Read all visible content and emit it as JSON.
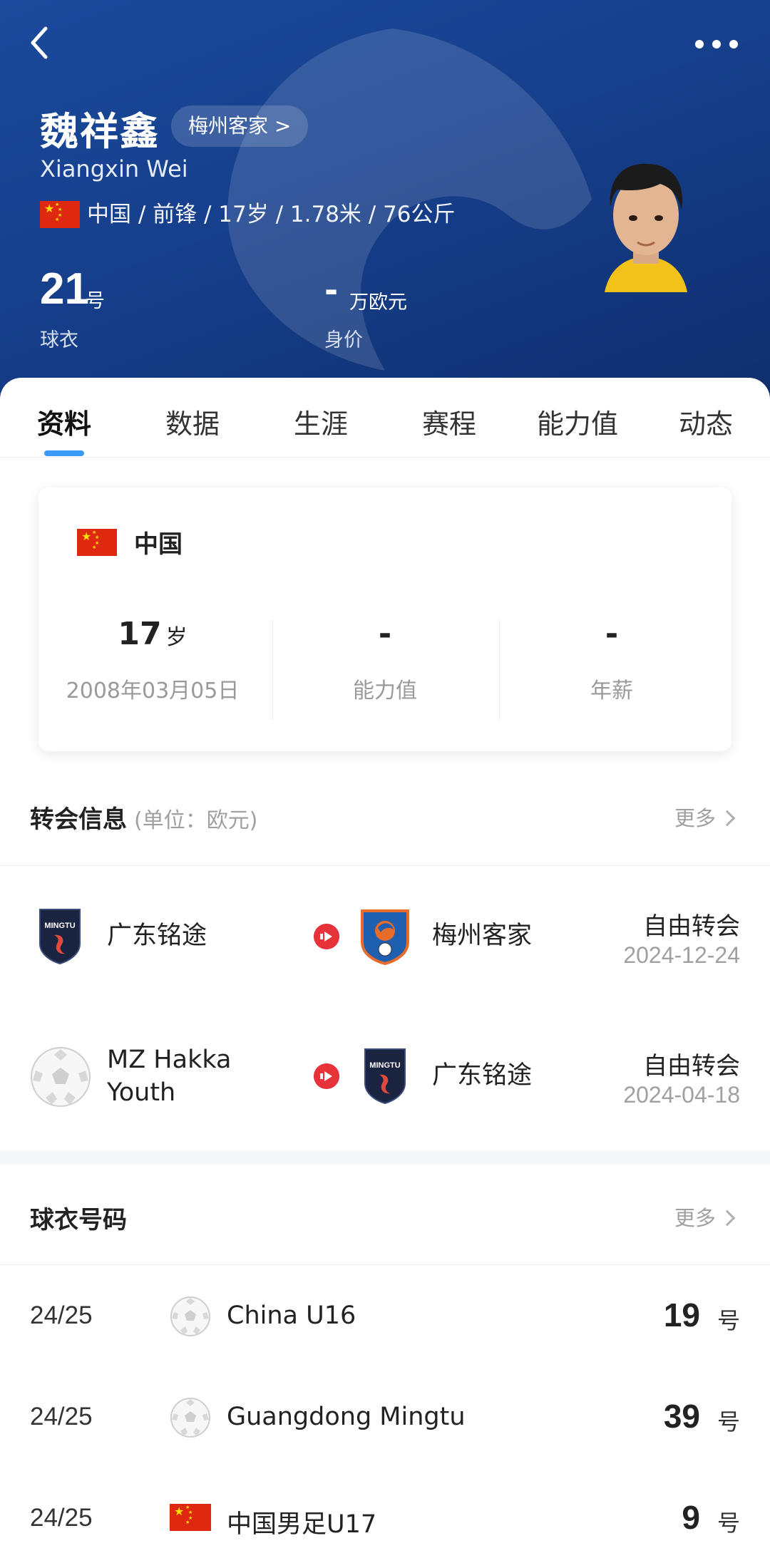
{
  "header": {
    "name_cn": "魏祥鑫",
    "team_link": "梅州客家 >",
    "name_en": "Xiangxin Wei",
    "info_line": "中国 / 前锋 / 17岁 / 1.78米 / 76公斤",
    "jersey_number": "21",
    "jersey_unit": "号",
    "jersey_label": "球衣",
    "market_value": "-",
    "market_value_unit": "万欧元",
    "market_value_label": "身价"
  },
  "tabs": [
    "资料",
    "数据",
    "生涯",
    "赛程",
    "能力值",
    "动态"
  ],
  "active_tab": "资料",
  "profile": {
    "country": "中国",
    "age": "17",
    "age_unit": "岁",
    "birthdate": "2008年03月05日",
    "ability": "-",
    "ability_label": "能力值",
    "salary": "-",
    "salary_label": "年薪"
  },
  "transfers": {
    "title": "转会信息",
    "subtitle": "(单位：欧元)",
    "more": "更多",
    "rows": [
      {
        "from": "广东铭途",
        "to": "梅州客家",
        "type": "自由转会",
        "date": "2024-12-24"
      },
      {
        "from_line1": "MZ Hakka",
        "from_line2": "Youth",
        "to": "广东铭途",
        "type": "自由转会",
        "date": "2024-04-18"
      }
    ]
  },
  "jerseys": {
    "title": "球衣号码",
    "more": "更多",
    "rows": [
      {
        "season": "24/25",
        "team": "China U16",
        "number": "19",
        "unit": "号",
        "icon": "soccer-ball-icon"
      },
      {
        "season": "24/25",
        "team": "Guangdong Mingtu",
        "number": "39",
        "unit": "号",
        "icon": "soccer-ball-icon"
      },
      {
        "season": "24/25",
        "team": "中国男足U17",
        "number": "9",
        "unit": "号",
        "icon": "china-flag-icon"
      }
    ]
  },
  "colors": {
    "header_bg": "#1b4a9c",
    "accent": "#3a9af5",
    "transfer_arrow": "#e8323a",
    "flag_red": "#de2910",
    "flag_yellow": "#ffde00"
  }
}
